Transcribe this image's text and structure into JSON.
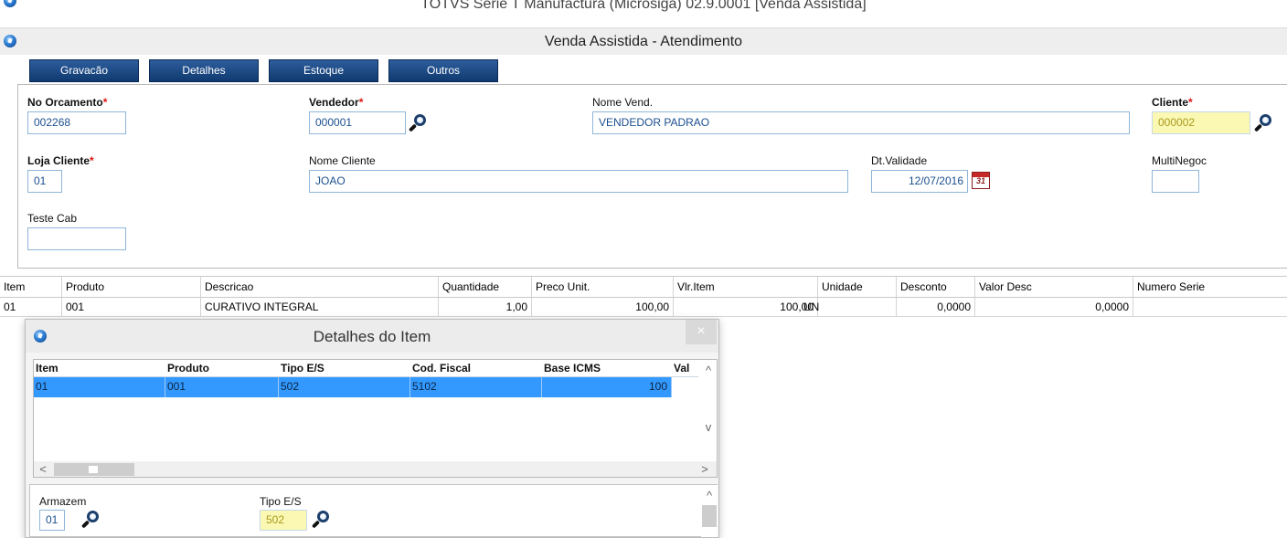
{
  "window": {
    "outer_title": "TOTVS Série T Manufactura (Microsiga) 02.9.0001 [Venda Assistida]",
    "inner_title": "Venda Assistida - Atendimento"
  },
  "toolbar": {
    "buttons": [
      "Gravacão",
      "Detalhes",
      "Estoque",
      "Outros"
    ]
  },
  "form": {
    "required_marker": "*",
    "no_orcamento": {
      "label": "No Orcamento",
      "value": "002268"
    },
    "vendedor": {
      "label": "Vendedor",
      "value": "000001"
    },
    "nome_vend": {
      "label": "Nome Vend.",
      "value": "VENDEDOR PADRAO"
    },
    "cliente": {
      "label": "Cliente",
      "value": "000002"
    },
    "loja_cliente": {
      "label": "Loja Cliente",
      "value": "01"
    },
    "nome_cliente": {
      "label": "Nome Cliente",
      "value": "JOAO"
    },
    "dt_validade": {
      "label": "Dt.Validade",
      "value": "12/07/2016",
      "calendar_glyph": "31"
    },
    "multinegoc": {
      "label": "MultiNegoc",
      "value": ""
    },
    "teste_cab": {
      "label": "Teste Cab",
      "value": ""
    }
  },
  "items_grid": {
    "columns": [
      "Item",
      "Produto",
      "Descricao",
      "Quantidade",
      "Preco Unit.",
      "Vlr.Item",
      "Unidade",
      "Desconto",
      "Valor Desc",
      "Numero Serie"
    ],
    "rows": [
      [
        "01",
        "001",
        "CURATIVO INTEGRAL",
        "1,00",
        "100,00",
        "100,00",
        "UN",
        "0,0000",
        "0,0000",
        ""
      ]
    ]
  },
  "dialog": {
    "title": "Detalhes do Item",
    "close_glyph": "×",
    "grid": {
      "columns": [
        "Item",
        "Produto",
        "Tipo E/S",
        "Cod. Fiscal",
        "Base ICMS",
        "Val"
      ],
      "rows": [
        [
          "01",
          "001",
          "502",
          "5102",
          "100",
          ""
        ]
      ]
    },
    "scroll_glyphs": {
      "up": "^",
      "down": "v",
      "left": "<",
      "right": ">"
    },
    "armazem": {
      "label": "Armazem",
      "value": "01"
    },
    "tipo_es": {
      "label": "Tipo E/S",
      "value": "502"
    }
  },
  "colors": {
    "toolbar_button": "#0f3a70",
    "selected_row": "#3399ff",
    "highlight_field": "#fbf8b3",
    "field_text": "#1b4f8f"
  }
}
